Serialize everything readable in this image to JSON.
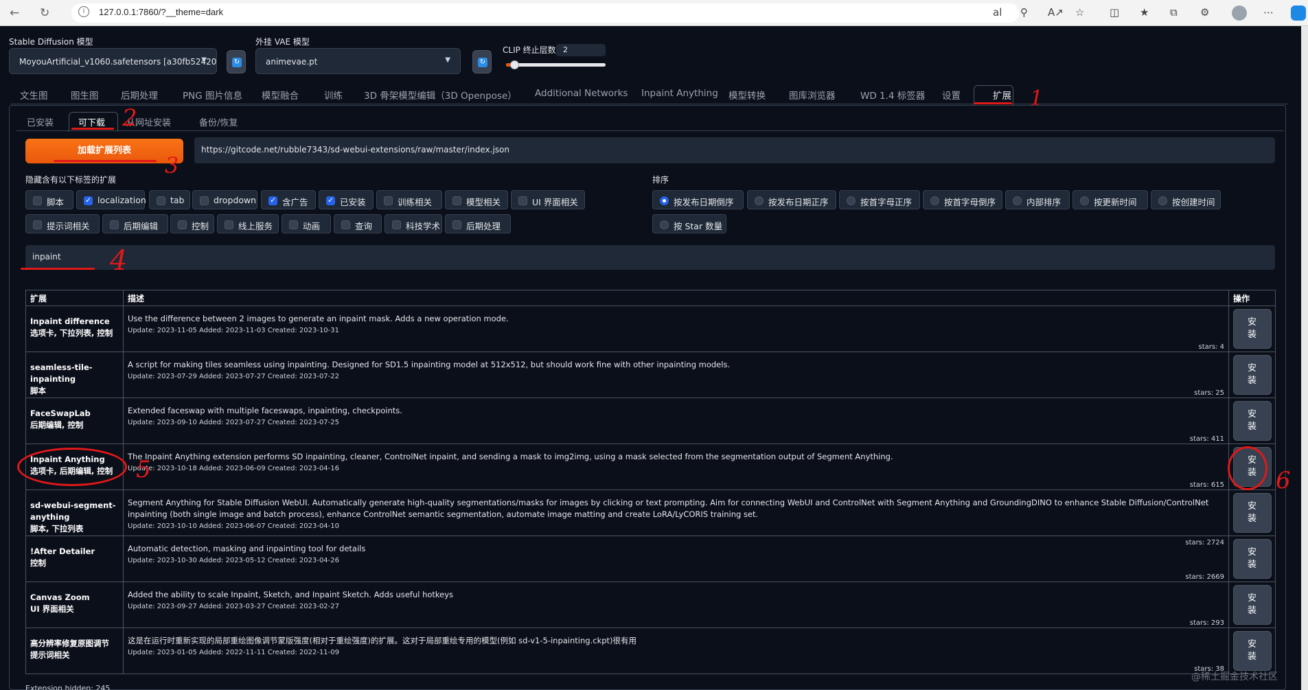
{
  "browser": {
    "url": "127.0.0.1:7860/?__theme=dark"
  },
  "settings": {
    "sd_model_label": "Stable Diffusion 模型",
    "sd_model_value": "MoyouArtificial_v1060.safetensors [a30fb52420",
    "vae_label": "外挂 VAE 模型",
    "vae_value": "animevae.pt",
    "clip_label": "CLIP 终止层数",
    "clip_value": "2",
    "clip_fraction": 0.08
  },
  "main_tabs": [
    "文生图",
    "图生图",
    "后期处理",
    "PNG 图片信息",
    "模型融合",
    "训练",
    "3D 骨架模型编辑（3D Openpose）",
    "Additional Networks",
    "Inpaint Anything",
    "模型转换",
    "图库浏览器",
    "WD 1.4 标签器",
    "设置",
    "扩展"
  ],
  "active_main_tab": "扩展",
  "sub_tabs": [
    "已安装",
    "可下载",
    "从网址安装",
    "备份/恢复"
  ],
  "active_sub_tab": "可下载",
  "load": {
    "button_label": "加载扩展列表",
    "url": "https://gitcode.net/rubble7343/sd-webui-extensions/raw/master/index.json"
  },
  "hide_filters": {
    "title": "隐藏含有以下标签的扩展",
    "items": [
      {
        "label": "脚本",
        "checked": false
      },
      {
        "label": "localization",
        "checked": true
      },
      {
        "label": "tab",
        "checked": false
      },
      {
        "label": "dropdown",
        "checked": false
      },
      {
        "label": "含广告",
        "checked": true
      },
      {
        "label": "已安装",
        "checked": true
      },
      {
        "label": "训练相关",
        "checked": false
      },
      {
        "label": "模型相关",
        "checked": false
      },
      {
        "label": "UI 界面相关",
        "checked": false
      },
      {
        "label": "提示词相关",
        "checked": false
      },
      {
        "label": "后期编辑",
        "checked": false
      },
      {
        "label": "控制",
        "checked": false
      },
      {
        "label": "线上服务",
        "checked": false
      },
      {
        "label": "动画",
        "checked": false
      },
      {
        "label": "查询",
        "checked": false
      },
      {
        "label": "科技学术",
        "checked": false
      },
      {
        "label": "后期处理",
        "checked": false
      }
    ]
  },
  "sort": {
    "title": "排序",
    "options": [
      {
        "label": "按发布日期倒序",
        "selected": true
      },
      {
        "label": "按发布日期正序",
        "selected": false
      },
      {
        "label": "按首字母正序",
        "selected": false
      },
      {
        "label": "按首字母倒序",
        "selected": false
      },
      {
        "label": "内部排序",
        "selected": false
      },
      {
        "label": "按更新时间",
        "selected": false
      },
      {
        "label": "按创建时间",
        "selected": false
      },
      {
        "label": "按 Star 数量",
        "selected": false
      }
    ]
  },
  "search": {
    "value": "inpaint"
  },
  "table": {
    "headers": {
      "name": "扩展",
      "desc": "描述",
      "action": "操作"
    },
    "install_label": "安装",
    "rows": [
      {
        "name": "Inpaint difference",
        "tags": "选项卡, 下拉列表, 控制",
        "desc": "Use the difference between 2 images to generate an inpaint mask. Adds a new operation mode.",
        "meta": "Update: 2023-11-05 Added: 2023-11-03 Created: 2023-10-31",
        "stars": "stars: 4"
      },
      {
        "name": "seamless-tile-inpainting",
        "tags": "脚本",
        "desc": "A script for making tiles seamless using inpainting. Designed for SD1.5 inpainting model at 512x512, but should work fine with other inpainting models.",
        "meta": "Update: 2023-07-29 Added: 2023-07-27 Created: 2023-07-22",
        "stars": "stars: 25"
      },
      {
        "name": "FaceSwapLab",
        "tags": "后期编辑, 控制",
        "desc": "Extended faceswap with multiple faceswaps, inpainting, checkpoints.",
        "meta": "Update: 2023-09-10 Added: 2023-07-27 Created: 2023-07-25",
        "stars": "stars: 411"
      },
      {
        "name": "Inpaint Anything",
        "tags": "选项卡, 后期编辑, 控制",
        "desc": "The Inpaint Anything extension performs SD inpainting, cleaner, ControlNet inpaint, and sending a mask to img2img, using a mask selected from the segmentation output of Segment Anything.",
        "meta": "Update: 2023-10-18 Added: 2023-06-09 Created: 2023-04-16",
        "stars": "stars: 615"
      },
      {
        "name": "sd-webui-segment-anything",
        "tags": "脚本, 下拉列表",
        "desc": "Segment Anything for Stable Diffusion WebUI. Automatically generate high-quality segmentations/masks for images by clicking or text prompting. Aim for connecting WebUI and ControlNet with Segment Anything and GroundingDINO to enhance Stable Diffusion/ControlNet inpainting (both single image and batch process), enhance ControlNet semantic segmentation, automate image matting and create LoRA/LyCORIS training set.",
        "meta": "Update: 2023-10-10 Added: 2023-06-07 Created: 2023-04-10",
        "stars": "stars: 2724"
      },
      {
        "name": "!After Detailer",
        "tags": "控制",
        "desc": "Automatic detection, masking and inpainting tool for details",
        "meta": "Update: 2023-10-30 Added: 2023-05-12 Created: 2023-04-26",
        "stars": "stars: 2669"
      },
      {
        "name": "Canvas Zoom",
        "tags": "UI 界面相关",
        "desc": "Added the ability to scale Inpaint, Sketch, and Inpaint Sketch. Adds useful hotkeys",
        "meta": "Update: 2023-09-27 Added: 2023-03-27 Created: 2023-02-27",
        "stars": "stars: 293"
      },
      {
        "name": "高分辨率修复原图调节",
        "tags": "提示词相关",
        "desc": "这是在运行时重新实现的局部重绘图像调节蒙版强度(相对于重绘强度)的扩展。这对于局部重绘专用的模型(例如 sd-v1-5-inpainting.ckpt)很有用",
        "meta": "Update: 2023-01-05 Added: 2022-11-11 Created: 2022-11-09",
        "stars": "stars: 38"
      }
    ]
  },
  "footer": "Extension hidden: 245",
  "watermark": "@稀土掘金技术社区",
  "annotations": [
    "1",
    "2",
    "3",
    "4",
    "5",
    "6"
  ]
}
